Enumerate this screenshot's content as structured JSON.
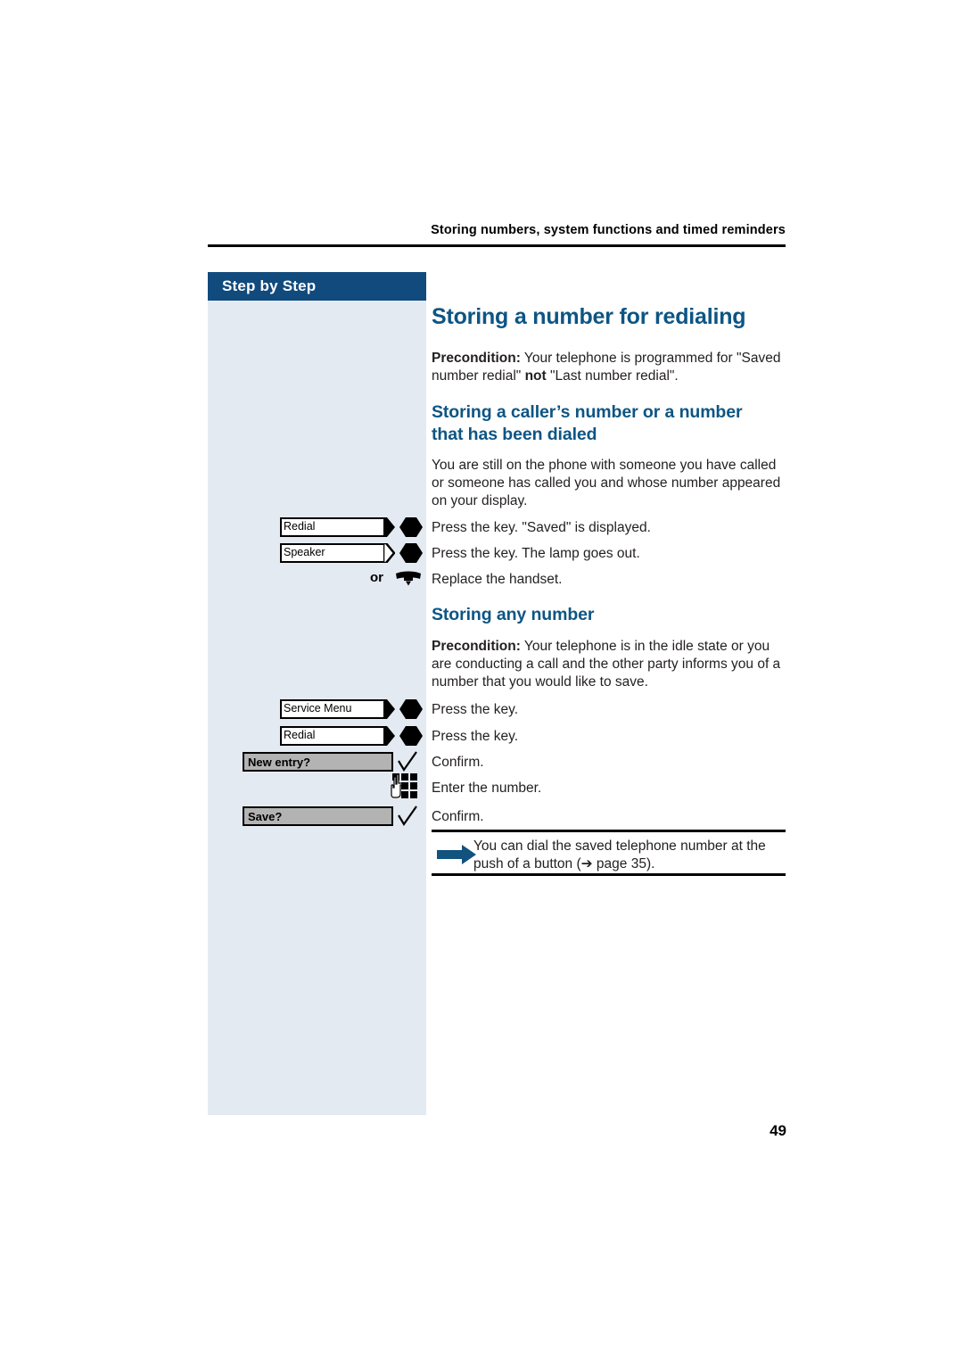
{
  "header": {
    "running_title": "Storing numbers, system functions and timed reminders"
  },
  "sidebar": {
    "header_label": "Step by Step"
  },
  "content": {
    "title": "Storing a number for redialing",
    "precondition1_bold": "Precondition:",
    "precondition1_rest": " Your telephone is programmed for \"Saved number redial\" ",
    "precondition1_bold2": "not",
    "precondition1_rest2": " \"Last number redial\".",
    "subtitle1": "Storing a caller’s number or a number that has been dialed",
    "paragraph1": "You are still on the phone with someone you have called or someone has called you and whose number appeared on your display.",
    "subtitle2": "Storing any number",
    "precondition2_bold": "Precondition:",
    "precondition2_rest": " Your telephone is in the idle state or you are conducting a call and the other party informs you of a number that you would like to save."
  },
  "steps_group1": [
    {
      "key_label": "Redial",
      "key_type": "hard-key-filled-tip",
      "instruction": "Press the key. \"Saved\" is displayed."
    },
    {
      "key_label": "Speaker",
      "key_type": "hard-key-open-tip",
      "instruction": "Press the key. The lamp goes out."
    },
    {
      "key_label": "",
      "key_type": "handset-or",
      "or_label": "or",
      "instruction": "Replace the handset."
    }
  ],
  "steps_group2": [
    {
      "key_label": "Service Menu",
      "key_type": "hard-key-filled-tip",
      "instruction": "Press the key."
    },
    {
      "key_label": "Redial",
      "key_type": "hard-key-filled-tip",
      "instruction": "Press the key."
    },
    {
      "key_label": "New entry?",
      "key_type": "softkey-checkmark",
      "instruction": "Confirm."
    },
    {
      "key_label": "",
      "key_type": "keypad",
      "instruction": "Enter the number."
    },
    {
      "key_label": "Save?",
      "key_type": "softkey-checkmark",
      "instruction": "Confirm."
    }
  ],
  "note": {
    "text": "You can dial the saved telephone number at the push of a button (➔ page 35).",
    "icon": "blue-arrow-icon"
  },
  "footer": {
    "page_number": "49"
  },
  "colors": {
    "heading_blue": "#0d5584",
    "sidebar_header_blue": "#114a7c",
    "sidebar_bg": "#e4eaf1",
    "note_arrow_blue": "#11527f",
    "softkey_gray": "#b3b3b3"
  }
}
